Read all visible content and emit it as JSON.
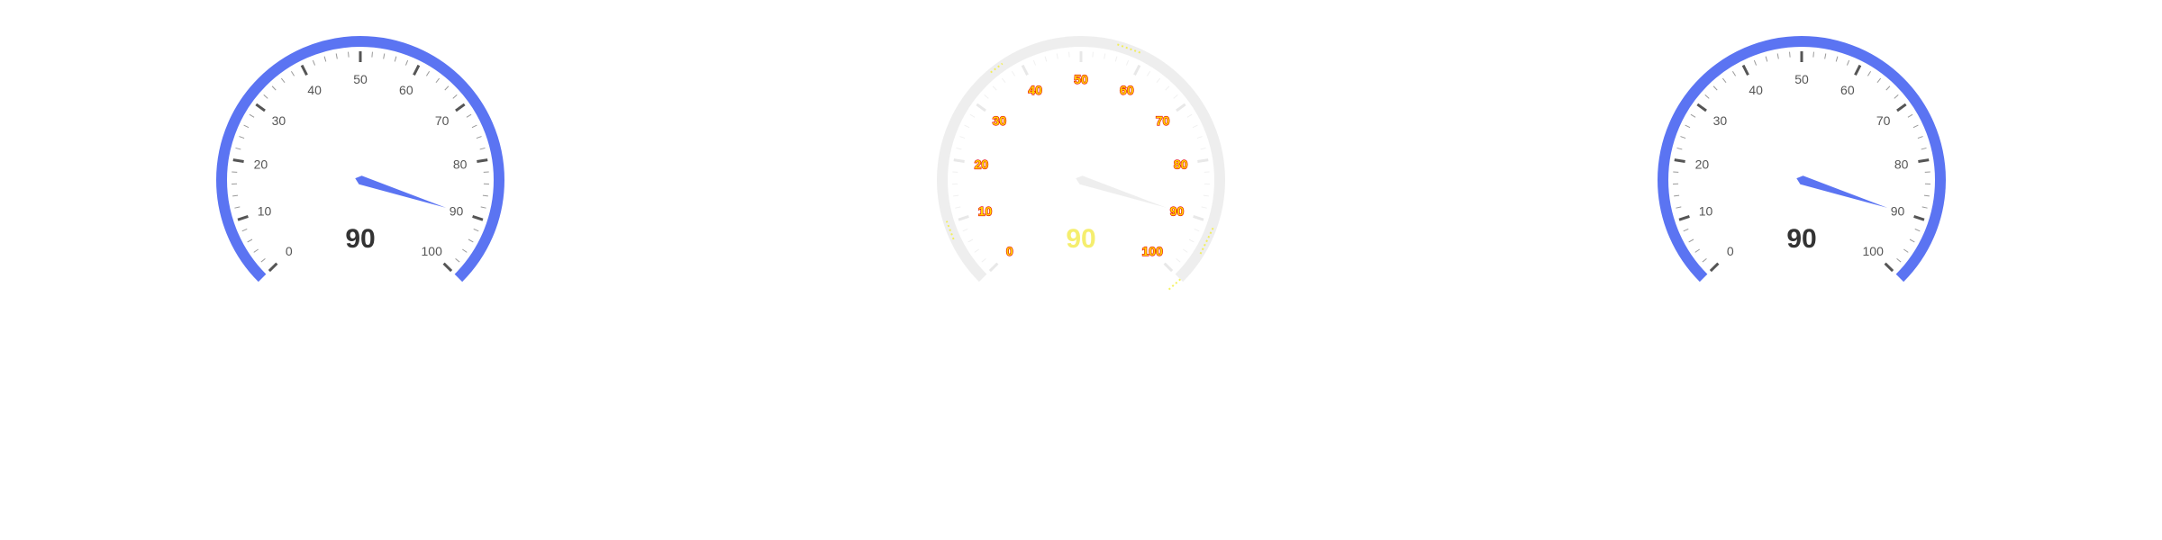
{
  "chart_data": [
    {
      "type": "gauge",
      "min": 0,
      "max": 100,
      "value": 90,
      "value_label": "90",
      "tick_labels": [
        "0",
        "10",
        "20",
        "30",
        "40",
        "50",
        "60",
        "70",
        "80",
        "90",
        "100"
      ],
      "style": "filled",
      "colors": {
        "arc": "#5b74f2",
        "pointer": "#5b74f2",
        "major_tick": "#555555",
        "minor_tick": "#999999",
        "label": "#555555",
        "value": "#333333"
      }
    },
    {
      "type": "gauge",
      "min": 0,
      "max": 100,
      "value": 90,
      "value_label": "90",
      "tick_labels": [
        "0",
        "10",
        "20",
        "30",
        "40",
        "50",
        "60",
        "70",
        "80",
        "90",
        "100"
      ],
      "style": "faded",
      "colors": {
        "arc": "#eeeeee",
        "pointer": "#eeeeee",
        "major_tick": "#e8e8e8",
        "minor_tick": "#f0f0f0",
        "label": "#ffd200",
        "label_shadow": "#e60000",
        "value": "#f5ee6e",
        "glitch": "#f2ef3a"
      }
    },
    {
      "type": "gauge",
      "min": 0,
      "max": 100,
      "value": 90,
      "value_label": "90",
      "tick_labels": [
        "0",
        "10",
        "20",
        "30",
        "40",
        "50",
        "60",
        "70",
        "80",
        "90",
        "100"
      ],
      "style": "filled",
      "colors": {
        "arc": "#5b74f2",
        "pointer": "#5b74f2",
        "major_tick": "#555555",
        "minor_tick": "#999999",
        "label": "#555555",
        "value": "#333333"
      }
    }
  ]
}
